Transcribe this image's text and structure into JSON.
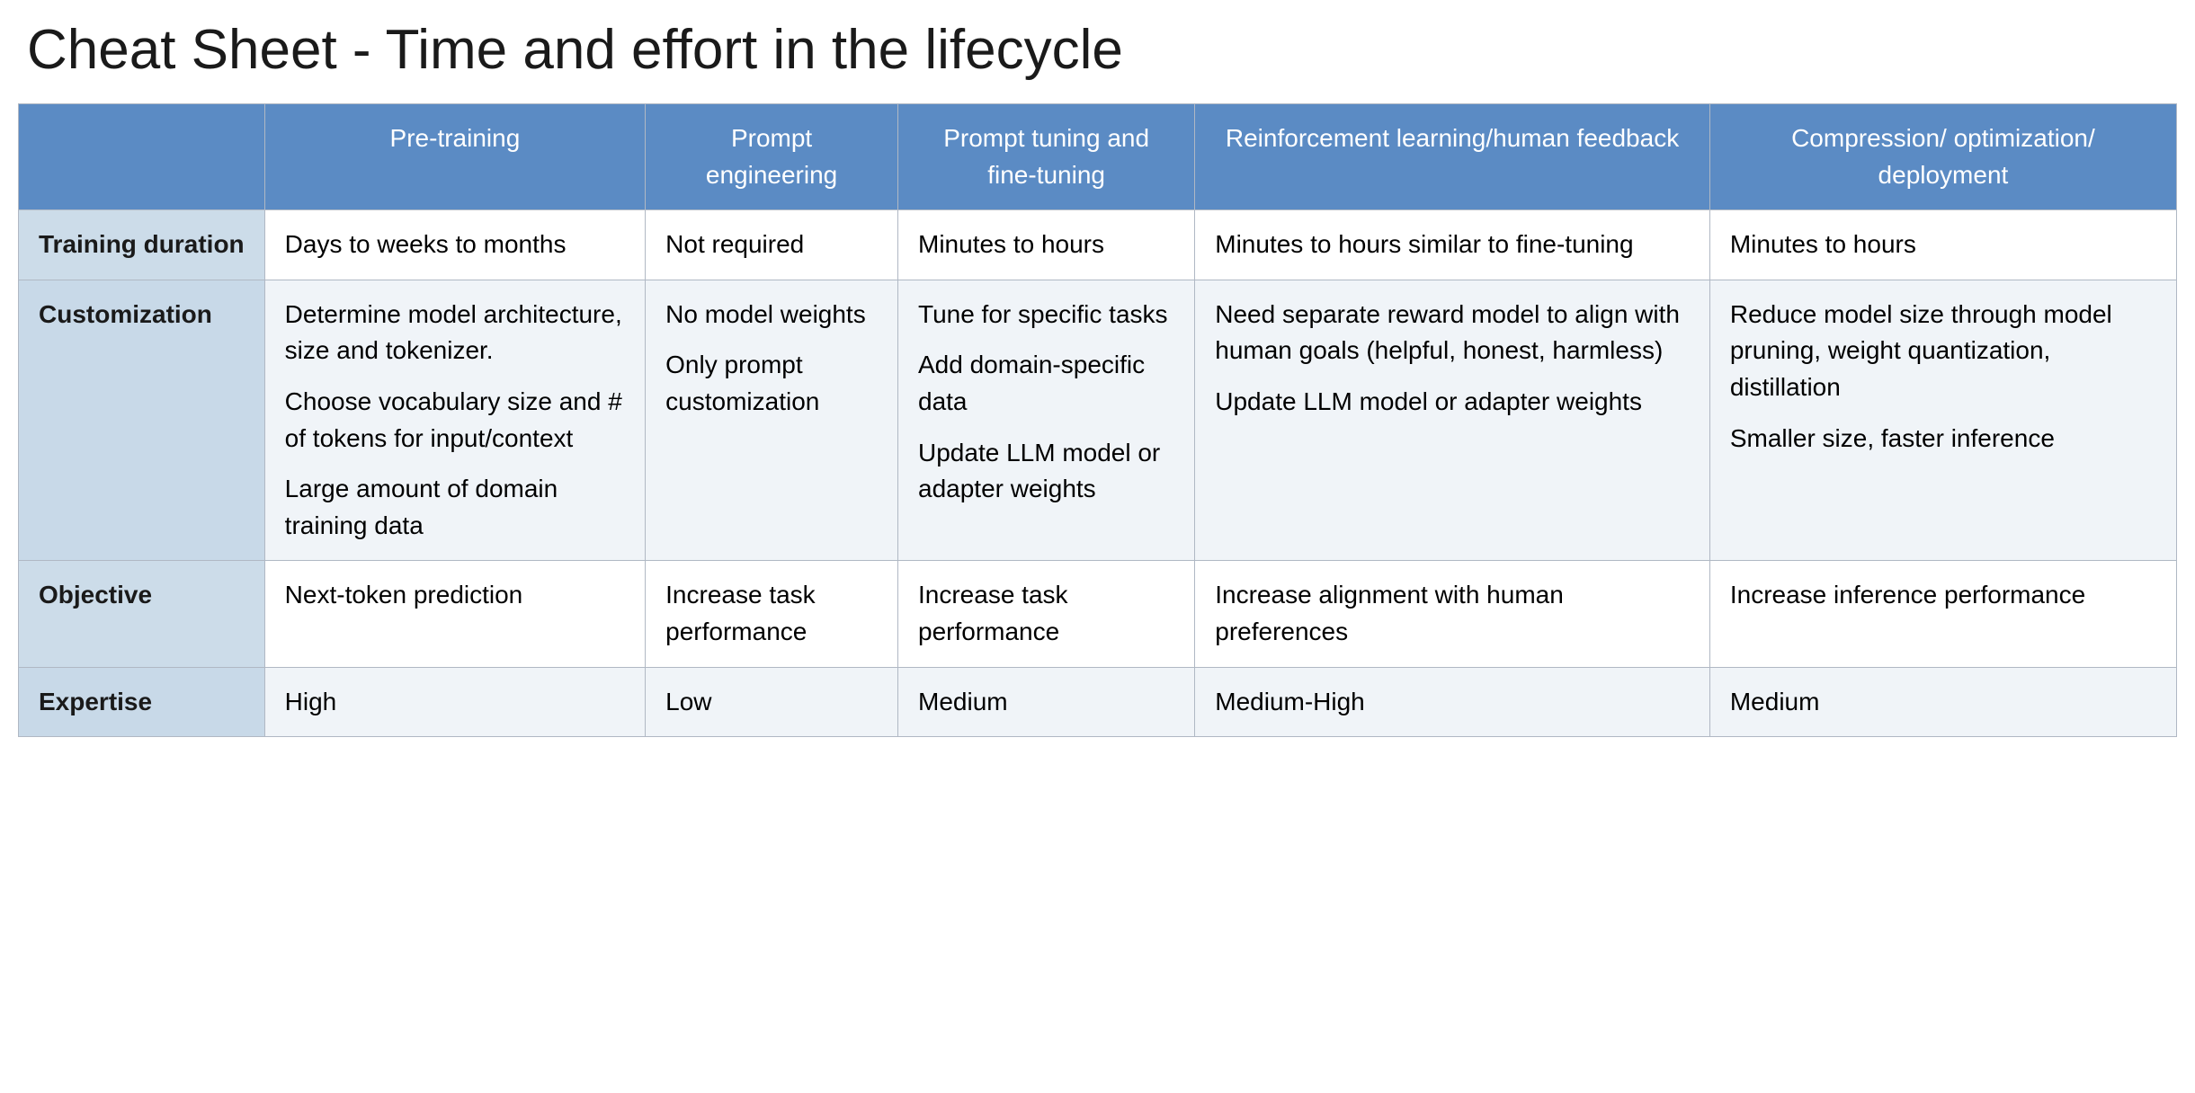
{
  "title": "Cheat Sheet - Time and effort in the lifecycle",
  "table": {
    "header": {
      "col0": "",
      "col1": "Pre-training",
      "col2": "Prompt engineering",
      "col3": "Prompt tuning and fine-tuning",
      "col4": "Reinforcement learning/human feedback",
      "col5": "Compression/ optimization/ deployment"
    },
    "rows": [
      {
        "label": "Training duration",
        "cells": [
          "Days to weeks to months",
          "Not required",
          "Minutes to hours",
          "Minutes to hours similar to fine-tuning",
          "Minutes to hours"
        ]
      },
      {
        "label": "Customization",
        "cells": [
          "Determine model architecture, size and tokenizer.\n\nChoose vocabulary size and # of tokens for input/context\n\nLarge amount of domain training data",
          "No model weights\n\nOnly prompt customization",
          "Tune for specific tasks\n\nAdd domain-specific data\n\nUpdate LLM model or adapter weights",
          "Need separate reward model to align with human goals (helpful, honest, harmless)\n\nUpdate LLM model or adapter weights",
          "Reduce model size through model pruning, weight quantization, distillation\n\nSmaller size, faster inference"
        ]
      },
      {
        "label": "Objective",
        "cells": [
          "Next-token prediction",
          "Increase task performance",
          "Increase task performance",
          "Increase alignment with human preferences",
          "Increase inference performance"
        ]
      },
      {
        "label": "Expertise",
        "cells": [
          "High",
          "Low",
          "Medium",
          "Medium-High",
          "Medium"
        ]
      }
    ]
  }
}
